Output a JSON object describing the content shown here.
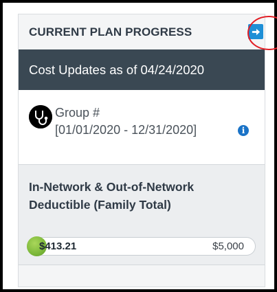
{
  "header": {
    "title": "CURRENT PLAN PROGRESS",
    "arrow_icon": "arrow-right-icon",
    "accent": "#1f8fd6"
  },
  "cost_banner": {
    "text": "Cost Updates as of 04/24/2020"
  },
  "group": {
    "avatar_icon": "stethoscope-icon",
    "label": "Group #",
    "date_range": "[01/01/2020 - 12/31/2020]",
    "info_icon": "info-icon",
    "info_glyph": "i"
  },
  "deductible": {
    "title": "In-Network & Out-of-Network Deductible (Family Total)",
    "spent": "$413.21",
    "max": "$5,000",
    "progress_fraction": 0.0826,
    "fill_color": "#8dc63f"
  },
  "annotation": {
    "ring_color": "#e21d24"
  }
}
